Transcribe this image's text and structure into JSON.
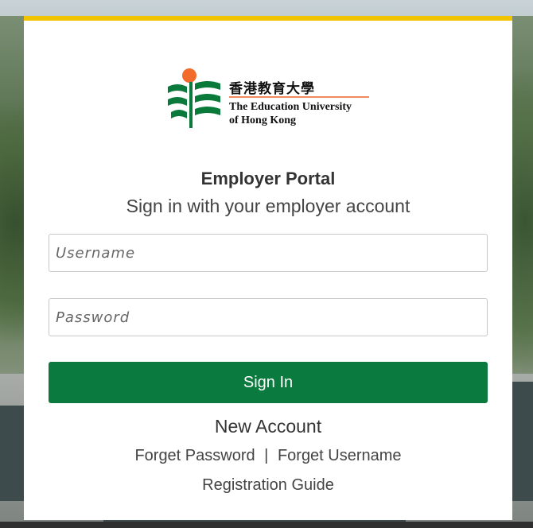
{
  "logo": {
    "name_cn": "香港教育大學",
    "name_en_line1": "The Education University",
    "name_en_line2": "of Hong Kong",
    "colors": {
      "green": "#0a7a3b",
      "orange": "#f26b2a"
    }
  },
  "portal": {
    "title": "Employer Portal",
    "subtitle": "Sign in with your employer account"
  },
  "form": {
    "username_placeholder": "Username",
    "username_value": "",
    "password_placeholder": "Password",
    "password_value": "",
    "signin_label": "Sign In"
  },
  "links": {
    "new_account": "New Account",
    "forget_password": "Forget Password",
    "separator": "|",
    "forget_username": "Forget Username",
    "registration_guide": "Registration Guide"
  },
  "colors": {
    "accent_bar": "#f2c300",
    "primary_button": "#0b7a3e"
  }
}
